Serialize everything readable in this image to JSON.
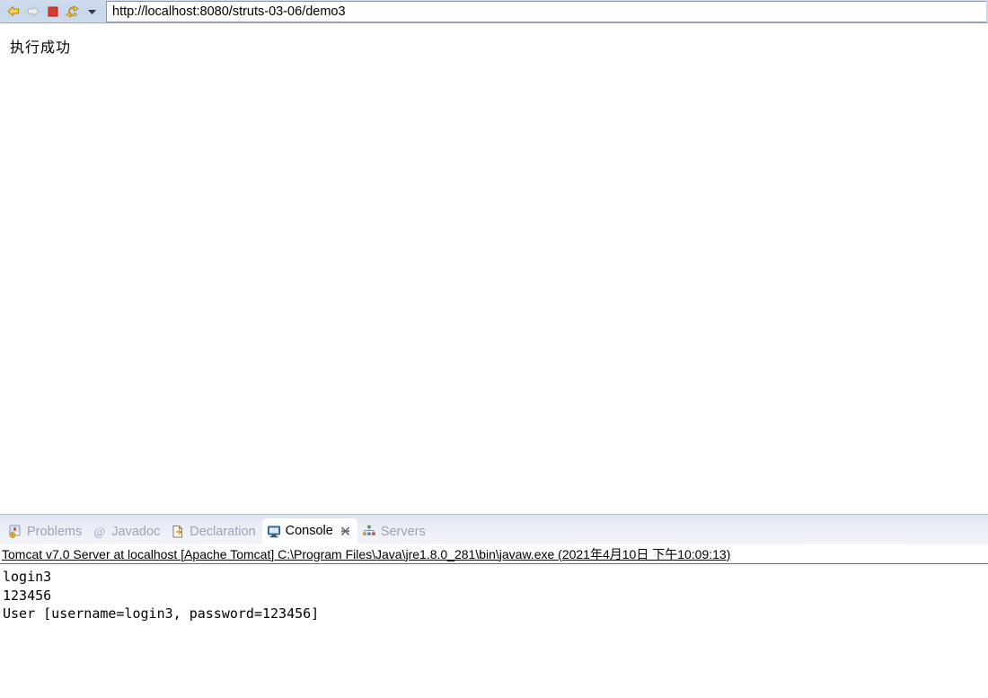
{
  "browser": {
    "toolbar": {
      "back_button": "back-arrow",
      "forward_button": "forward-arrow",
      "stop_button": "stop-square",
      "refresh_button": "refresh-arrows",
      "dropdown_button": "chevron-down"
    },
    "address_bar": {
      "value": "http://localhost:8080/struts-03-06/demo3",
      "placeholder": "http://"
    }
  },
  "page": {
    "body_text": "执行成功"
  },
  "bottom_panel": {
    "tabs": [
      {
        "label": "Problems",
        "icon": "problems-icon",
        "active": false
      },
      {
        "label": "Javadoc",
        "icon": "javadoc-icon",
        "active": false
      },
      {
        "label": "Declaration",
        "icon": "declaration-icon",
        "active": false
      },
      {
        "label": "Console",
        "icon": "console-icon",
        "active": true
      },
      {
        "label": "Servers",
        "icon": "servers-icon",
        "active": false
      }
    ],
    "console": {
      "status_line": "Tomcat v7.0 Server at localhost [Apache Tomcat] C:\\Program Files\\Java\\jre1.8.0_281\\bin\\javaw.exe (2021年4月10日 下午10:09:13)",
      "output_lines": [
        "login3",
        "123456",
        "User [username=login3, password=123456]"
      ]
    }
  },
  "colors": {
    "toolbar_bg": "#c7d6ea",
    "toolbar_border": "#9aaac2",
    "tabbar_gradient_top": "#dee4f1",
    "tabbar_gradient_bottom": "#f3f4f9",
    "tab_inactive_text": "#9aa4b8",
    "tab_active_text": "#000000",
    "tab_active_bg": "#fcfdfe",
    "back_arrow": "#e8a300",
    "forward_arrow": "#d8d8d8",
    "stop_square": "#e03a2f",
    "refresh_arrows": "#e8a300",
    "console_text": "#000000",
    "status_border": "#6e6e6e"
  }
}
